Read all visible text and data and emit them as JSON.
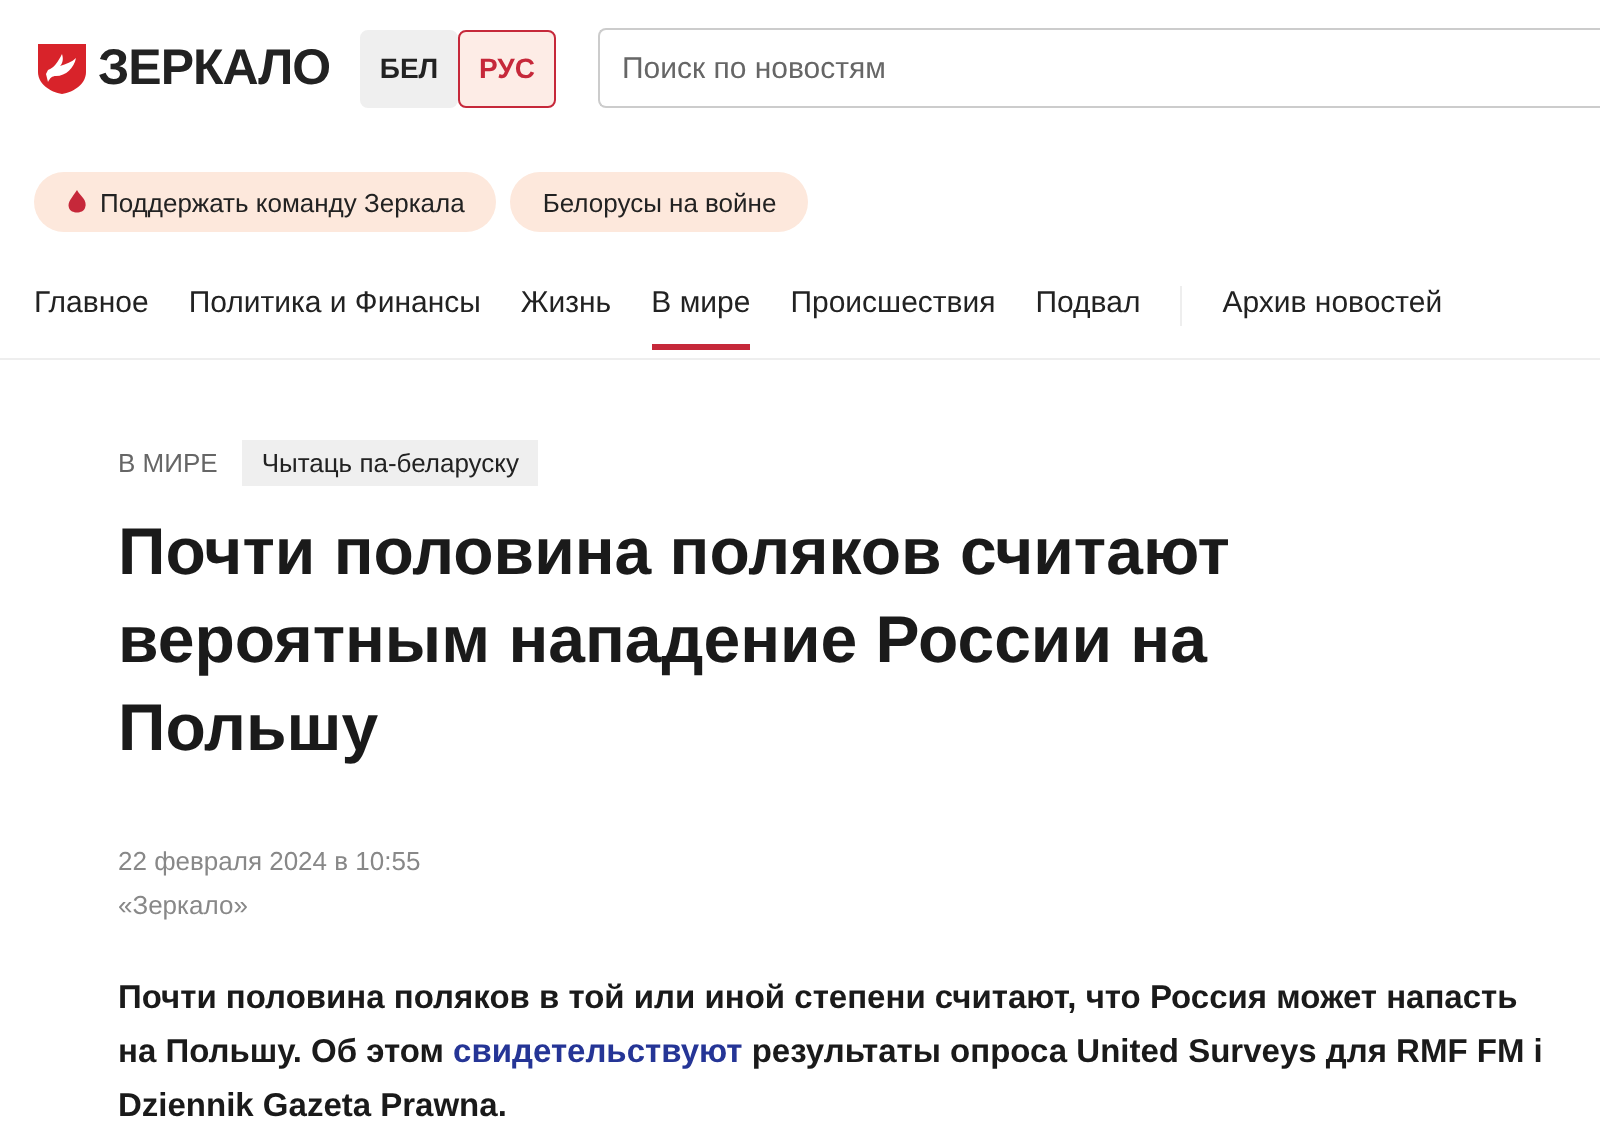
{
  "logo": {
    "text": "ЗЕРКАЛО"
  },
  "languages": [
    {
      "label": "БЕЛ",
      "selected": false
    },
    {
      "label": "РУС",
      "selected": true
    }
  ],
  "search": {
    "placeholder": "Поиск по новостям"
  },
  "promos": [
    {
      "label": "Поддержать команду Зеркала",
      "kind": "flame"
    },
    {
      "label": "Белорусы на войне",
      "kind": "plain"
    }
  ],
  "nav": [
    {
      "label": "Главное",
      "selected": false,
      "kind": "section"
    },
    {
      "label": "Политика и Финансы",
      "selected": false,
      "kind": "section"
    },
    {
      "label": "Жизнь",
      "selected": false,
      "kind": "section"
    },
    {
      "label": "В мире",
      "selected": true,
      "kind": "section"
    },
    {
      "label": "Происшествия",
      "selected": false,
      "kind": "section"
    },
    {
      "label": "Подвал",
      "selected": false,
      "kind": "section"
    },
    {
      "label": "Архив новостей",
      "selected": false,
      "kind": "archive"
    }
  ],
  "article": {
    "category": "В МИРЕ",
    "translate": "Чытаць па-беларуску",
    "title": "Почти половина поляков считают вероятным нападение России на Польшу",
    "date": "22 февраля 2024 в 10:55",
    "source": "«Зеркало»",
    "lead_before": "Почти половина поляков в той или иной степени считают, что Россия может напасть на Польшу. Об этом ",
    "lead_link": "свидетельствуют",
    "lead_after": " результаты опроса United Surveys для RMF FM i Dziennik Gazeta Prawna."
  }
}
